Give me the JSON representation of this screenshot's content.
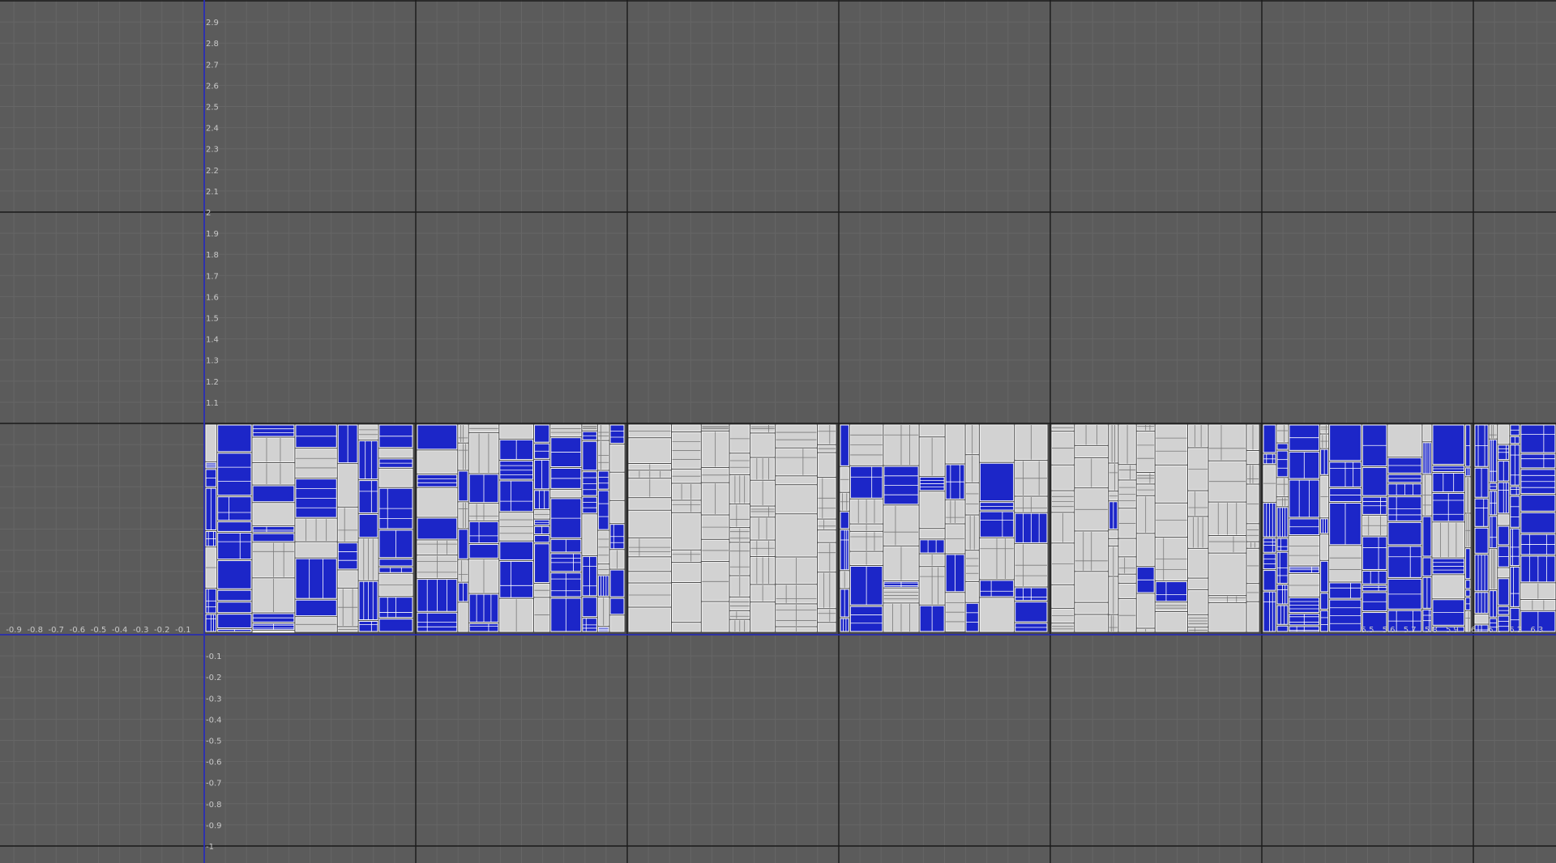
{
  "view": {
    "u_ticks_negative": [
      "-0.9",
      "-0.8",
      "-0.7",
      "-0.6",
      "-0.5",
      "-0.4",
      "-0.3",
      "-0.2",
      "-0.1"
    ],
    "u_ticks_positive_right": [
      "5.5",
      "5.6",
      "5.7",
      "5.8",
      "5.9",
      "6",
      "6.1",
      "6.2",
      "6.3"
    ],
    "v_ticks_positive": [
      "2.9",
      "2.8",
      "2.7",
      "2.6",
      "2.5",
      "2.4",
      "2.3",
      "2.2",
      "2.1",
      "2",
      "1.9",
      "1.8",
      "1.7",
      "1.6",
      "1.5",
      "1.4",
      "1.3",
      "1.2",
      "1.1"
    ],
    "v_ticks_negative": [
      "-0.1",
      "-0.2",
      "-0.3",
      "-0.4",
      "-0.5",
      "-0.6",
      "-0.7",
      "-0.8",
      "-0.9",
      "-1"
    ]
  },
  "uv_tiles": [
    {
      "u": 0,
      "selected_fraction": 0.7
    },
    {
      "u": 1,
      "selected_fraction": 0.55
    },
    {
      "u": 2,
      "selected_fraction": 0.0
    },
    {
      "u": 3,
      "selected_fraction": 0.45
    },
    {
      "u": 4,
      "selected_fraction": 0.05
    },
    {
      "u": 5,
      "selected_fraction": 0.75
    },
    {
      "u": 6,
      "selected_fraction": 0.85
    }
  ],
  "colors": {
    "background": "#5b5b5b",
    "grid_fine": "#666666",
    "grid_major": "#1a1a1a",
    "axis": "#2a2fc8",
    "tick_label": "#c8c8c8",
    "uv_shell": "#d2d2d2",
    "uv_selected": "#1c26c8",
    "uv_edge": "#ffffff",
    "uv_gap": "#4a4a4a"
  }
}
